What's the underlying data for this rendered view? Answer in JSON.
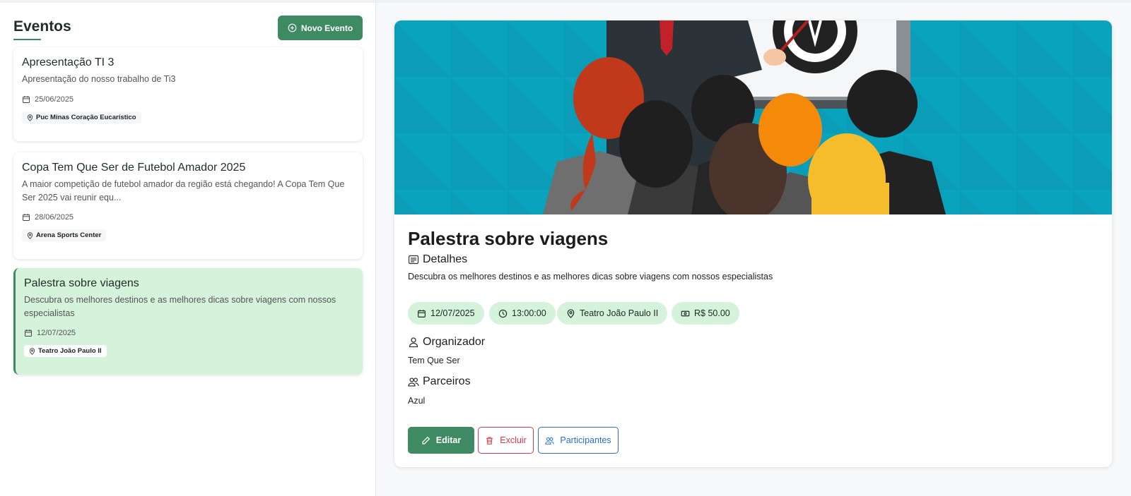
{
  "sidebar": {
    "title": "Eventos",
    "new_button_label": "Novo Evento",
    "events": [
      {
        "title": "Apresentação TI 3",
        "description": "Apresentação do nosso trabalho de Ti3",
        "date": "25/06/2025",
        "location": "Puc Minas Coração Eucarístico"
      },
      {
        "title": "Copa Tem Que Ser de Futebol Amador 2025",
        "description": "A maior competição de futebol amador da região está chegando! A Copa Tem Que Ser 2025 vai reunir equ...",
        "date": "28/06/2025",
        "location": "Arena Sports Center"
      },
      {
        "title": "Palestra sobre viagens",
        "description": "Descubra os melhores destinos e as melhores dicas sobre viagens com nossos especialistas",
        "date": "12/07/2025",
        "location": "Teatro João Paulo II",
        "selected": true
      }
    ]
  },
  "detail": {
    "title": "Palestra sobre viagens",
    "details_heading": "Detalhes",
    "description": "Descubra os melhores destinos e as melhores dicas sobre viagens com nossos especialistas",
    "date": "12/07/2025",
    "time": "13:00:00",
    "location": "Teatro João Paulo II",
    "price": "R$ 50.00",
    "organizer_heading": "Organizador",
    "organizer": "Tem Que Ser",
    "partners_heading": "Parceiros",
    "partners": "Azul",
    "actions": {
      "edit": "Editar",
      "delete": "Excluir",
      "participants": "Participantes"
    }
  },
  "colors": {
    "primary": "#3e8a62",
    "selected_bg": "#d5f2db",
    "danger": "#dc3545",
    "info": "#2a6fd6",
    "hero_bg": "#0aa2bd"
  }
}
